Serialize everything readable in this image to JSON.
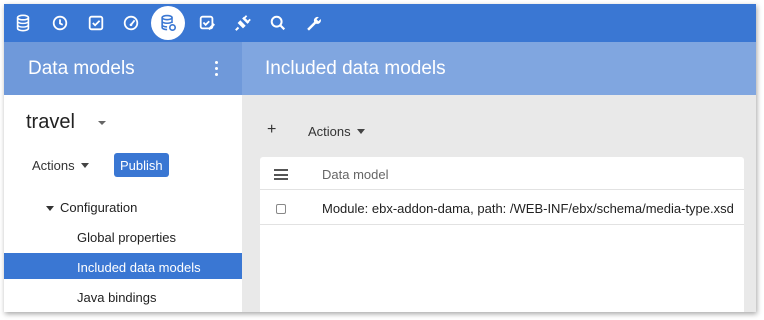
{
  "colors": {
    "topbar": "#3a77d3",
    "header": "#80a6e0",
    "selected": "#3a77d3"
  },
  "topbar": {
    "icons": [
      "database-icon",
      "clock-icon",
      "checkbox-icon",
      "gauge-icon",
      "database-settings-icon",
      "check-edit-icon",
      "plug-icon",
      "search-icon",
      "wrench-icon"
    ],
    "active_icon": "database-settings-icon"
  },
  "header": {
    "left_title": "Data models",
    "right_title": "Included data models"
  },
  "left": {
    "dataset_name": "travel",
    "actions_label": "Actions",
    "publish_label": "Publish",
    "tree": {
      "configuration": "Configuration",
      "global_properties": "Global properties",
      "included_data_models": "Included data models",
      "java_bindings": "Java bindings"
    }
  },
  "right": {
    "add_label": "+",
    "actions_label": "Actions",
    "table": {
      "column_header": "Data model",
      "rows": [
        {
          "data_model": "Module: ebx-addon-dama, path: /WEB-INF/ebx/schema/media-type.xsd"
        }
      ]
    }
  }
}
